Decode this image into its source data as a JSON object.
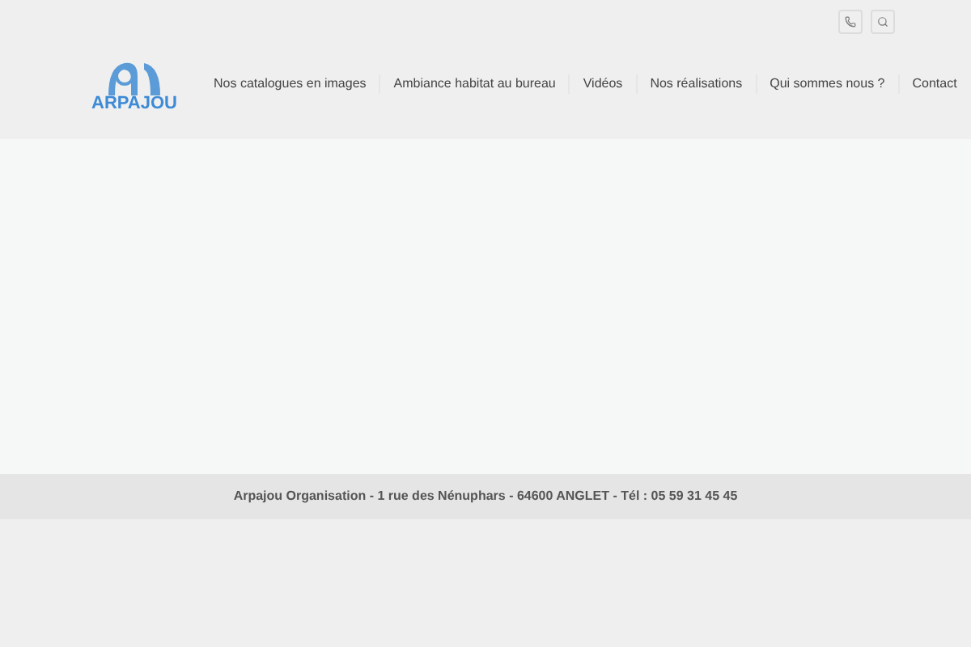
{
  "logo": {
    "text": "ARPAJOU"
  },
  "nav": [
    {
      "label": "Nos catalogues en images"
    },
    {
      "label": "Ambiance habitat au bureau"
    },
    {
      "label": "Vidéos"
    },
    {
      "label": "Nos réalisations"
    },
    {
      "label": "Qui sommes nous ?"
    },
    {
      "label": "Contact"
    }
  ],
  "footer": {
    "text": "Arpajou Organisation - 1 rue des Nénuphars - 64600 ANGLET - Tél : 05 59 31 45 45"
  }
}
